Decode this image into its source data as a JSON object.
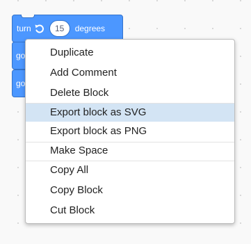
{
  "blocks": {
    "turn": {
      "label": "turn",
      "icon": "rotate-left-icon",
      "value": "15",
      "suffix": "degrees"
    },
    "go_1": {
      "label": "go"
    },
    "go_2": {
      "label": "go"
    }
  },
  "context_menu": {
    "items": [
      {
        "label": "Duplicate"
      },
      {
        "label": "Add Comment"
      },
      {
        "label": "Delete Block"
      },
      {
        "label": "Export block as SVG",
        "highlighted": true
      },
      {
        "label": "Export block as PNG"
      },
      {
        "label": "Make Space"
      },
      {
        "label": "Copy All"
      },
      {
        "label": "Copy Block"
      },
      {
        "label": "Cut Block"
      }
    ]
  },
  "colors": {
    "block_fill": "#4c97ff",
    "block_border": "#3373cc",
    "menu_highlight": "#d3e4f4",
    "canvas_background": "#f9f9f9"
  }
}
